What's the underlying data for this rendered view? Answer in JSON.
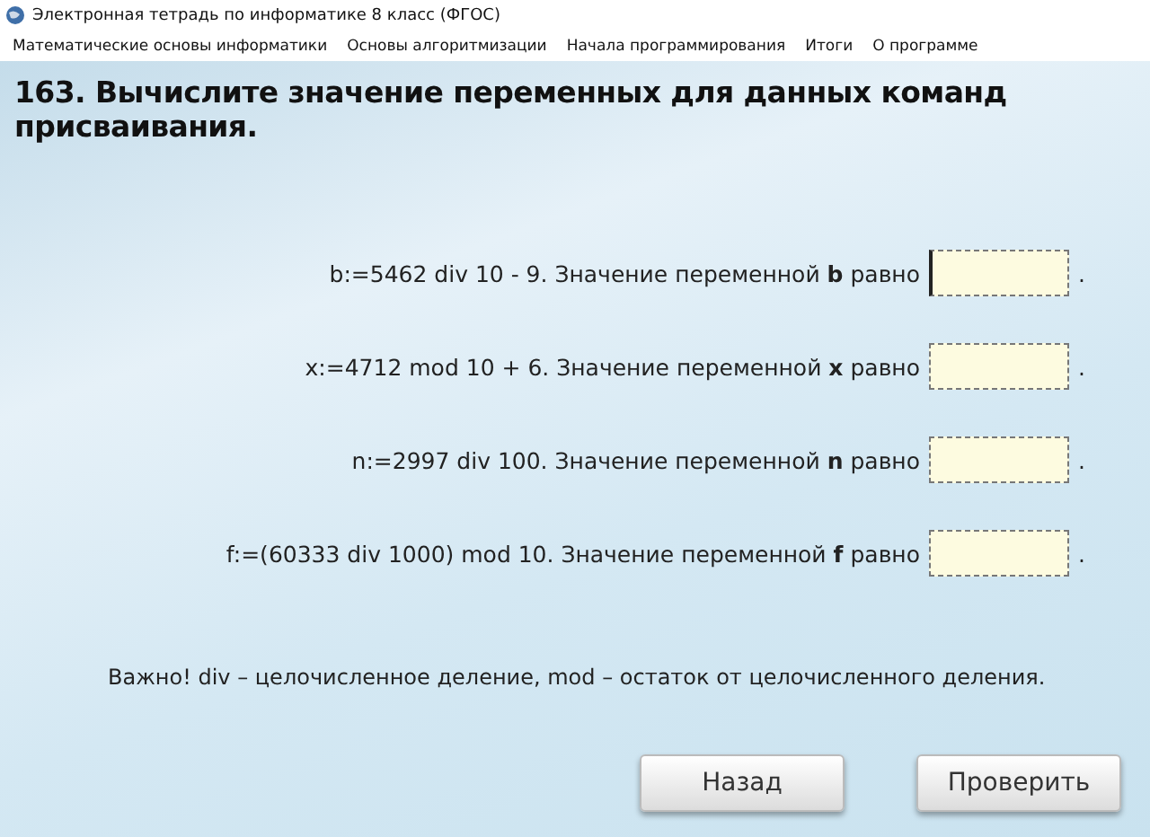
{
  "window": {
    "title": "Электронная тетрадь по информатике 8 класс (ФГОС)"
  },
  "menu": [
    "Математические основы информатики",
    "Основы алгоритмизации",
    "Начала программирования",
    "Итоги",
    "О программе"
  ],
  "heading": "163. Вычислите значение переменных для данных команд присваивания.",
  "questions": [
    {
      "text": "b:=5462 div 10 - 9. Значение переменной **b** равно",
      "focused": true,
      "end": "."
    },
    {
      "text": "x:=4712 mod 10 + 6. Значение переменной **x** равно",
      "focused": false,
      "end": "."
    },
    {
      "text": "n:=2997 div 100. Значение переменной **n** равно",
      "focused": false,
      "end": "."
    },
    {
      "text": "f:=(60333 div 1000) mod 10. Значение переменной **f** равно",
      "focused": false,
      "end": "."
    }
  ],
  "note": "Важно! div – целочисленное деление, mod – остаток от целочисленного деления.",
  "buttons": [
    "Назад",
    "Проверить"
  ]
}
